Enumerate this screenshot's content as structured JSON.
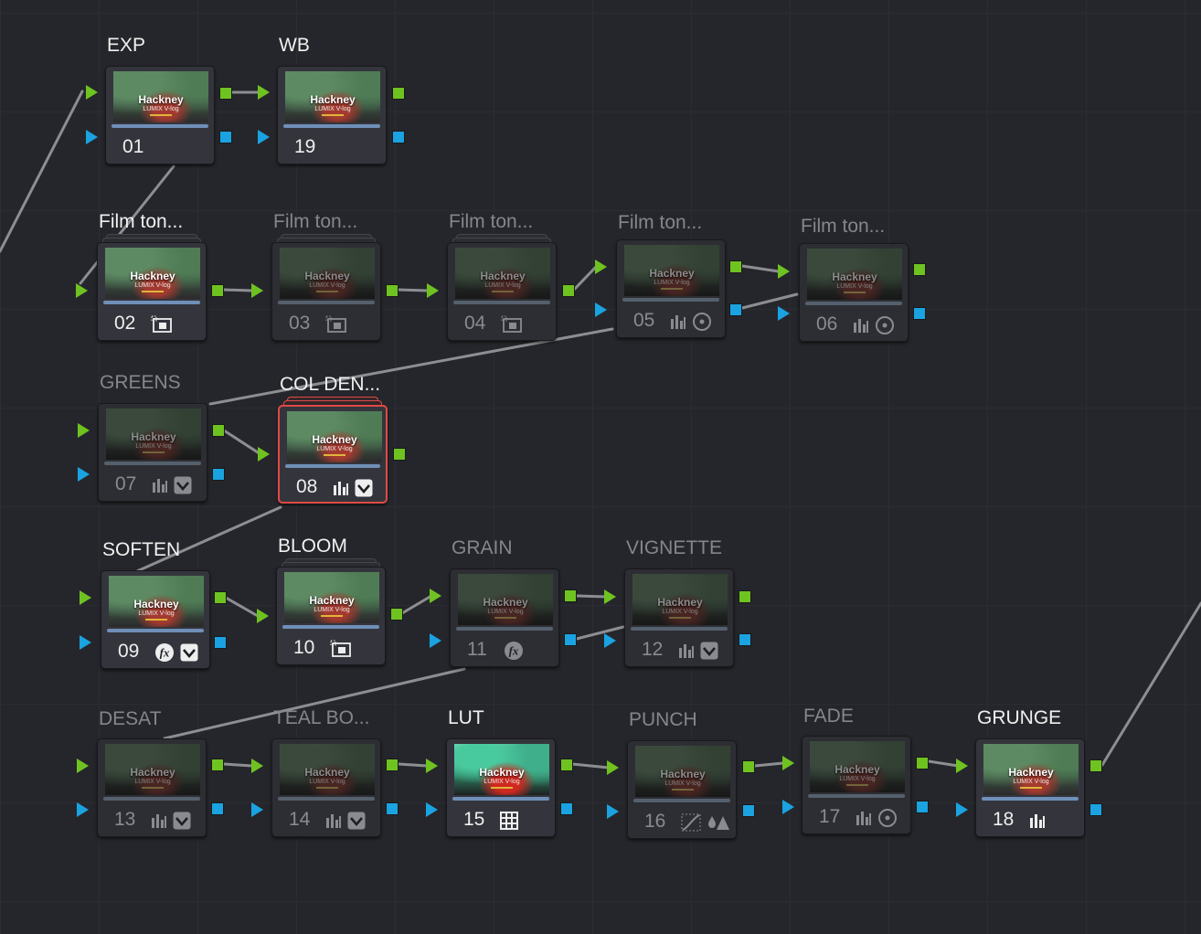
{
  "colors": {
    "rgb_input": "#6fc321",
    "alpha_input": "#1aa3e0",
    "selected_border": "#e04a45",
    "link": "#8d8e92"
  },
  "nodes": [
    {
      "id": "n01",
      "label": "EXP",
      "number": "01",
      "enabled": true,
      "tools": [],
      "thumb": {
        "title": "Hackney",
        "subtitle": "LUMIX V-log"
      }
    },
    {
      "id": "n19",
      "label": "WB",
      "number": "19",
      "enabled": true,
      "tools": [],
      "thumb": {
        "title": "Hackney",
        "subtitle": "LUMIX V-log"
      }
    },
    {
      "id": "n02",
      "label": "Film ton...",
      "number": "02",
      "enabled": true,
      "tools": [
        "tracker-icon"
      ],
      "thumb": {
        "title": "Hackney",
        "subtitle": "LUMIX V-log"
      }
    },
    {
      "id": "n03",
      "label": "Film ton...",
      "number": "03",
      "enabled": false,
      "tools": [
        "tracker-icon"
      ],
      "thumb": {
        "title": "Hackney",
        "subtitle": "LUMIX V-log"
      }
    },
    {
      "id": "n04",
      "label": "Film ton...",
      "number": "04",
      "enabled": false,
      "tools": [
        "tracker-icon"
      ],
      "thumb": {
        "title": "Hackney",
        "subtitle": "LUMIX V-log"
      }
    },
    {
      "id": "n05",
      "label": "Film ton...",
      "number": "05",
      "enabled": false,
      "tools": [
        "bars-icon",
        "circle-window-icon"
      ],
      "thumb": {
        "title": "Hackney",
        "subtitle": "LUMIX V-log"
      }
    },
    {
      "id": "n06",
      "label": "Film ton...",
      "number": "06",
      "enabled": false,
      "tools": [
        "bars-icon",
        "circle-window-icon"
      ],
      "thumb": {
        "title": "Hackney",
        "subtitle": "LUMIX V-log"
      }
    },
    {
      "id": "n07",
      "label": "GREENS",
      "number": "07",
      "enabled": false,
      "tools": [
        "bars-icon",
        "qualifier-icon"
      ],
      "thumb": {
        "title": "Hackney",
        "subtitle": "LUMIX V-log"
      }
    },
    {
      "id": "n08",
      "label": "COL DEN...",
      "number": "08",
      "enabled": true,
      "selected": true,
      "tools": [
        "bars-icon",
        "qualifier-icon"
      ],
      "thumb": {
        "title": "Hackney",
        "subtitle": "LUMIX V-log"
      }
    },
    {
      "id": "n09",
      "label": "SOFTEN",
      "number": "09",
      "enabled": true,
      "tools": [
        "fx-icon",
        "qualifier-icon"
      ],
      "thumb": {
        "title": "Hackney",
        "subtitle": "LUMIX V-log"
      }
    },
    {
      "id": "n10",
      "label": "BLOOM",
      "number": "10",
      "enabled": true,
      "tools": [
        "tracker-icon"
      ],
      "thumb": {
        "title": "Hackney",
        "subtitle": "LUMIX V-log"
      }
    },
    {
      "id": "n11",
      "label": "GRAIN",
      "number": "11",
      "enabled": false,
      "tools": [
        "fx-icon"
      ],
      "thumb": {
        "title": "Hackney",
        "subtitle": "LUMIX V-log"
      }
    },
    {
      "id": "n12",
      "label": "VIGNETTE",
      "number": "12",
      "enabled": false,
      "tools": [
        "bars-icon",
        "qualifier-icon"
      ],
      "thumb": {
        "title": "Hackney",
        "subtitle": "LUMIX V-log"
      }
    },
    {
      "id": "n13",
      "label": "DESAT",
      "number": "13",
      "enabled": false,
      "tools": [
        "bars-icon",
        "qualifier-icon"
      ],
      "thumb": {
        "title": "Hackney",
        "subtitle": "LUMIX V-log"
      }
    },
    {
      "id": "n14",
      "label": "TEAL BO...",
      "number": "14",
      "enabled": false,
      "tools": [
        "bars-icon",
        "qualifier-icon"
      ],
      "thumb": {
        "title": "Hackney",
        "subtitle": "LUMIX V-log"
      }
    },
    {
      "id": "n15",
      "label": "LUT",
      "number": "15",
      "enabled": true,
      "lut": true,
      "tools": [
        "lut-grid-icon"
      ],
      "thumb": {
        "title": "Hackney",
        "subtitle": "LUMIX V-log"
      }
    },
    {
      "id": "n16",
      "label": "PUNCH",
      "number": "16",
      "enabled": false,
      "tools": [
        "curves-icon",
        "hsl-icon"
      ],
      "thumb": {
        "title": "Hackney",
        "subtitle": "LUMIX V-log"
      }
    },
    {
      "id": "n17",
      "label": "FADE",
      "number": "17",
      "enabled": false,
      "tools": [
        "bars-icon",
        "circle-window-icon"
      ],
      "thumb": {
        "title": "Hackney",
        "subtitle": "LUMIX V-log"
      }
    },
    {
      "id": "n18",
      "label": "GRUNGE",
      "number": "18",
      "enabled": true,
      "tools": [
        "bars-icon"
      ],
      "thumb": {
        "title": "Hackney",
        "subtitle": "LUMIX V-log"
      }
    }
  ]
}
